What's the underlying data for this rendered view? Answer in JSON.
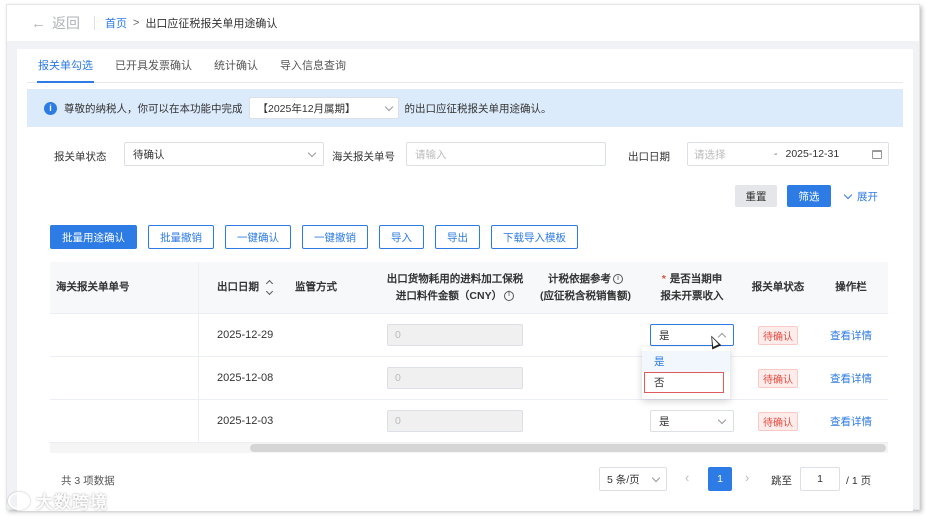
{
  "topbar": {
    "back_label": "返回",
    "breadcrumb_home": "首页",
    "breadcrumb_sep": ">",
    "breadcrumb_current": "出口应征税报关单用途确认"
  },
  "tabs": [
    {
      "label": "报关单勾选",
      "active": true
    },
    {
      "label": "已开具发票确认",
      "active": false
    },
    {
      "label": "统计确认",
      "active": false
    },
    {
      "label": "导入信息查询",
      "active": false
    }
  ],
  "notice": {
    "prefix": "尊敬的纳税人，你可以在本功能中完成",
    "period": "【2025年12月属期】",
    "suffix": "的出口应征税报关单用途确认。"
  },
  "filters": {
    "status_label": "报关单状态",
    "status_value": "待确认",
    "customs_no_label": "海关报关单号",
    "customs_no_placeholder": "请输入",
    "export_date_label": "出口日期",
    "date_start_placeholder": "请选择",
    "date_sep": "-",
    "date_end": "2025-12-31"
  },
  "filter_buttons": {
    "reset": "重置",
    "filter": "筛选",
    "expand": "展开"
  },
  "actions": [
    "批量用途确认",
    "批量撤销",
    "一键确认",
    "一键撤销",
    "导入",
    "导出",
    "下载导入模板"
  ],
  "table": {
    "headers": {
      "customs_no": "海关报关单单号",
      "export_date": "出口日期",
      "supervision": "监管方式",
      "amount_line1": "出口货物耗用的进料加工保税",
      "amount_line2": "进口料件金额（CNY）",
      "tax_basis_line1": "计税依据参考",
      "tax_basis_line2": "(应征税含税销售额)",
      "required_mark": "*",
      "invoiced_line1": "是否当期申",
      "invoiced_line2": "报未开票收入",
      "status": "报关单状态",
      "ops": "操作栏"
    },
    "rows": [
      {
        "export_date": "2025-12-29",
        "amount": "0",
        "invoiced": "是",
        "status": "待确认",
        "action": "查看详情"
      },
      {
        "export_date": "2025-12-08",
        "amount": "0",
        "invoiced": "是",
        "status": "待确认",
        "action": "查看详情"
      },
      {
        "export_date": "2025-12-03",
        "amount": "0",
        "invoiced": "是",
        "status": "待确认",
        "action": "查看详情"
      }
    ]
  },
  "dropdown": {
    "options": [
      "是",
      "否"
    ],
    "selected": "是",
    "highlighted": "否"
  },
  "pagination": {
    "total": "共 3 项数据",
    "page_size": "5 条/页",
    "current": "1",
    "jump_label": "跳至",
    "jump_value": "1",
    "total_pages": "/ 1 页"
  },
  "watermark": "大数跨境",
  "colors": {
    "primary": "#2d7be5",
    "danger": "#e54d42",
    "notice_bg": "#dcebfb"
  }
}
